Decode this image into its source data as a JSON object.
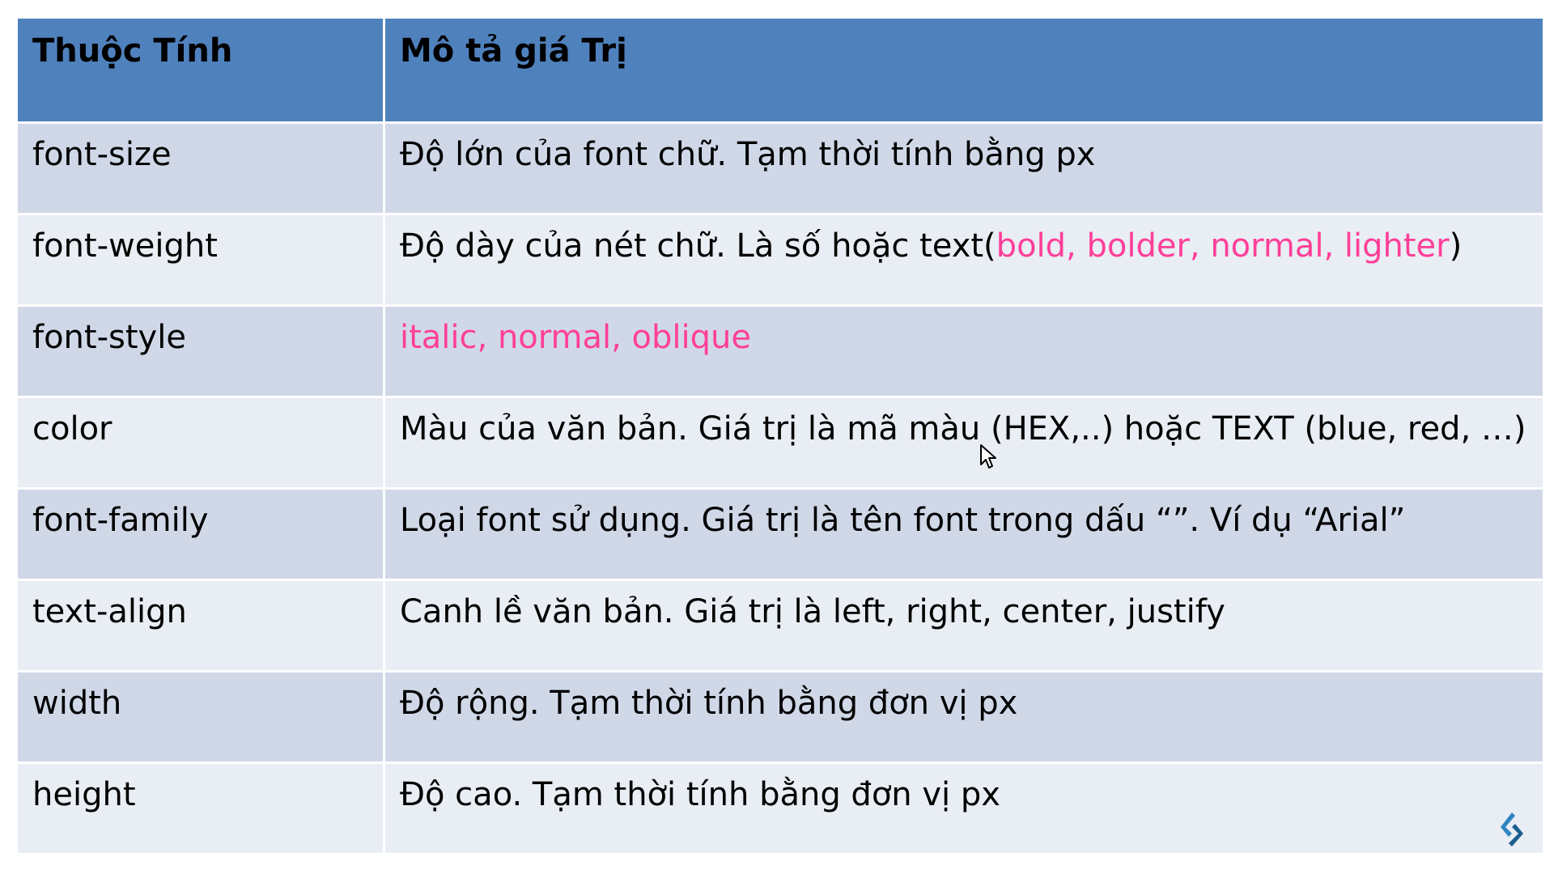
{
  "table": {
    "headers": [
      "Thuộc Tính",
      "Mô tả giá Trị"
    ],
    "rows": [
      {
        "property": "font-size",
        "description": "Độ lớn của font chữ. Tạm thời tính bằng px"
      },
      {
        "property": "font-weight",
        "description_prefix": "Độ dày của nét chữ. Là số hoặc text(",
        "description_highlight": "bold, bolder, normal, lighter",
        "description_suffix": ")"
      },
      {
        "property": "font-style",
        "description_highlight": "italic, normal, oblique"
      },
      {
        "property": "color",
        "description": "Màu của văn bản. Giá trị là mã màu (HEX,..) hoặc TEXT (blue, red, …)"
      },
      {
        "property": "font-family",
        "description": "Loại font sử dụng. Giá trị là tên font trong dấu “”. Ví dụ “Arial”"
      },
      {
        "property": "text-align",
        "description": "Canh lề văn bản. Giá trị là left, right, center, justify"
      },
      {
        "property": "width",
        "description": "Độ rộng. Tạm thời tính bằng đơn vị px"
      },
      {
        "property": "height",
        "description": "Độ cao. Tạm thời tính bằng đơn vị px"
      }
    ]
  },
  "colors": {
    "header_bg": "#4f81bd",
    "row_odd_bg": "#d0d8e8",
    "row_even_bg": "#e9edf4",
    "highlight_text": "#ff3f98"
  },
  "icons": {
    "cursor": "mouse-pointer-icon",
    "logo": "brand-logo-icon"
  }
}
